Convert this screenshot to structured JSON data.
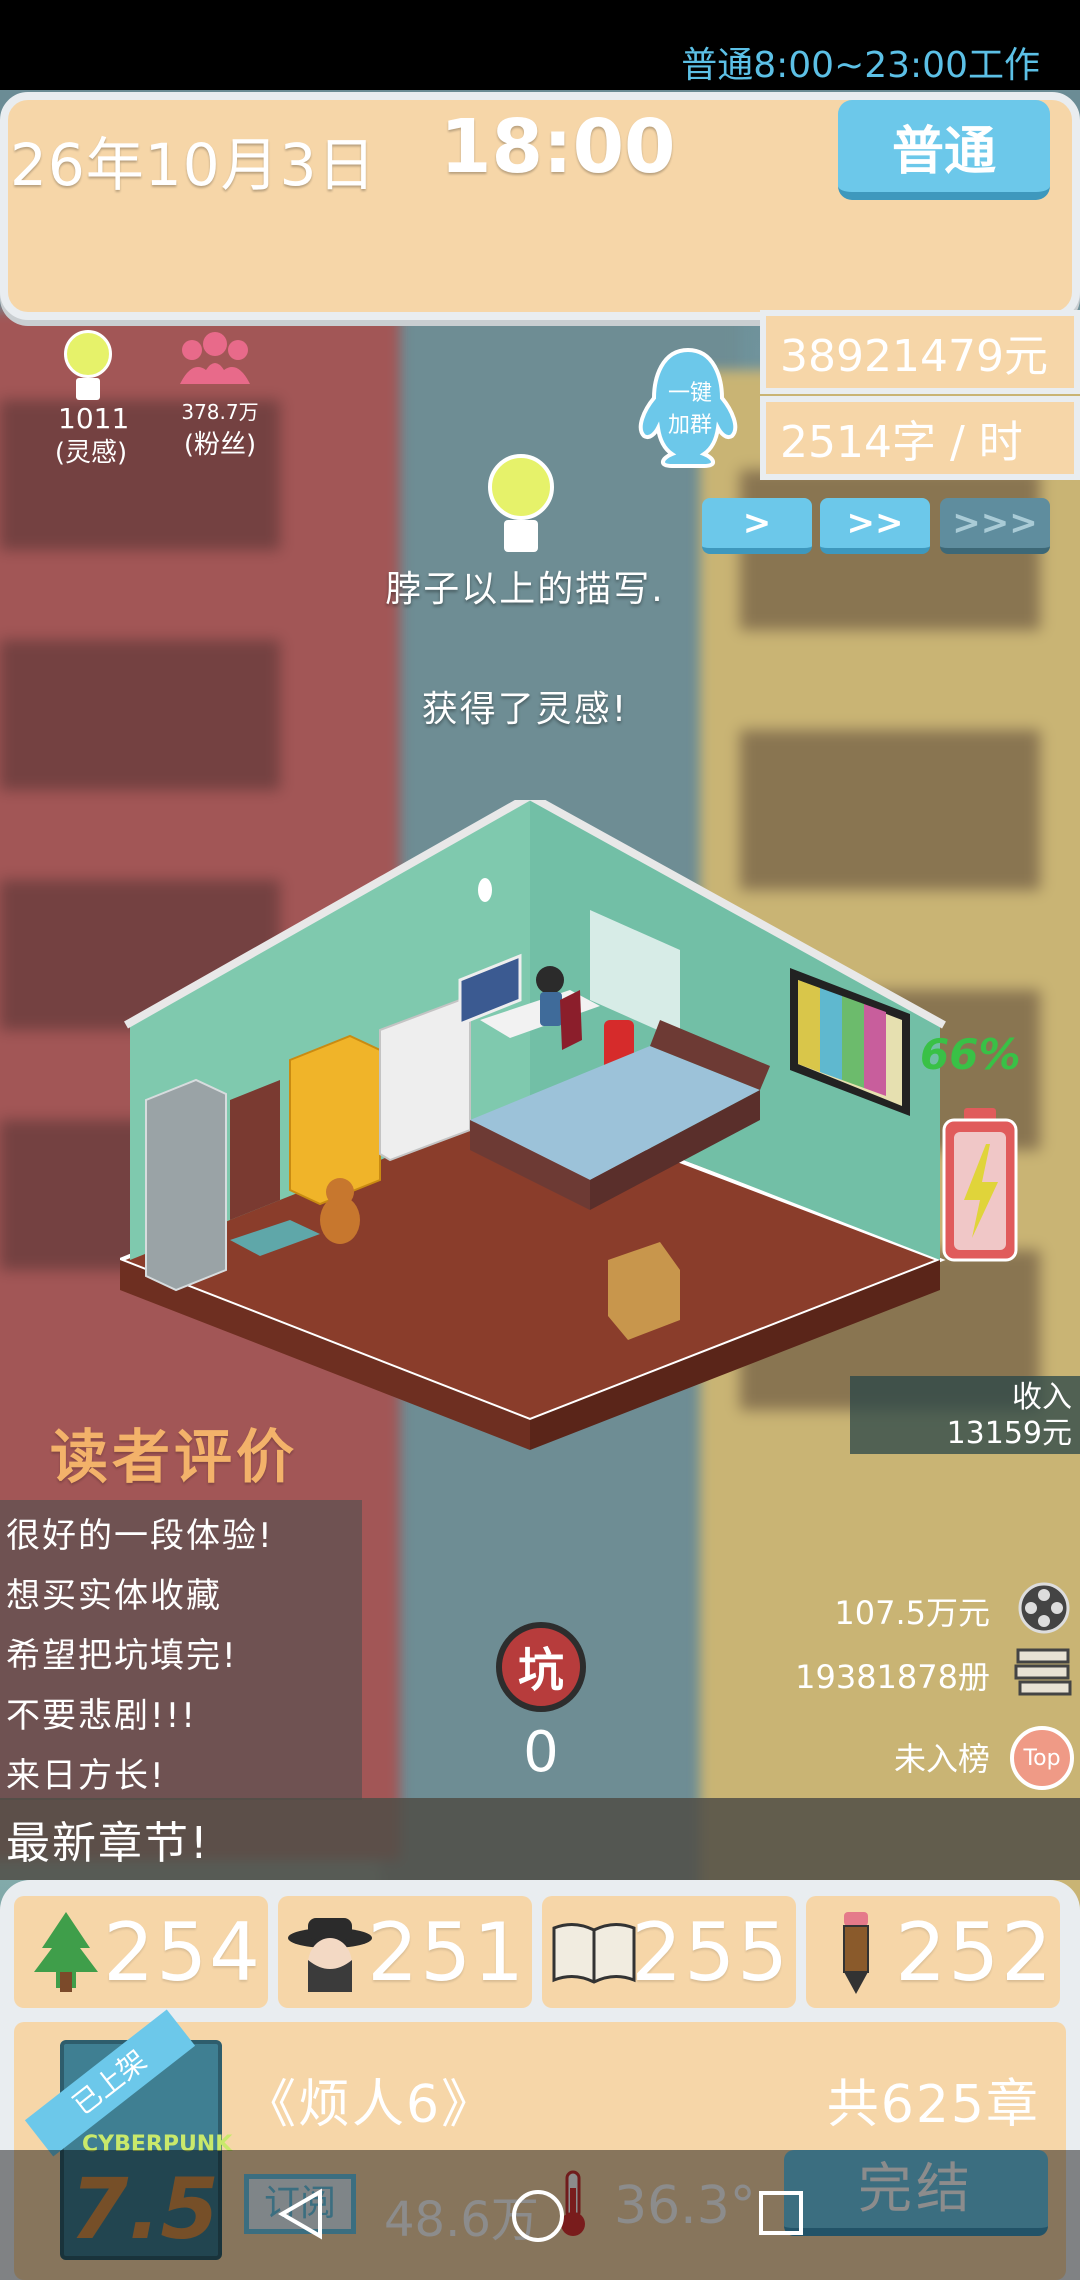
{
  "header": {
    "work_hours": "普通8:00~23:00工作",
    "date": "26年10月3日",
    "time": "18:00",
    "mode_label": "普通"
  },
  "stats": {
    "money": "38921479元",
    "speed": "2514字 / 时",
    "inspiration_value": "1011",
    "inspiration_label": "(灵感)",
    "fans_value": "378.7万",
    "fans_label": "(粉丝)"
  },
  "qq_group": {
    "line1": "一键",
    "line2": "加群"
  },
  "speed_buttons": [
    ">",
    ">>",
    ">>>"
  ],
  "messages": {
    "line1": "脖子以上的描写.",
    "line2": "获得了灵感!"
  },
  "battery": {
    "percent_text": "66%",
    "level": 0.66
  },
  "income": {
    "label": "收入",
    "value": "13159元"
  },
  "reviews": {
    "title": "读者评价",
    "items": [
      "很好的一段体验!",
      "想买实体收藏",
      "希望把坑填完!",
      "不要悲剧!!!",
      "来日方长!"
    ]
  },
  "sales": {
    "money": "107.5万元",
    "copies": "19381878册",
    "rank": "未入榜",
    "top_badge": "Top"
  },
  "pit": {
    "label": "坑",
    "count": "0"
  },
  "latest_chapter": "最新章节!",
  "attributes": [
    {
      "icon": "tree-icon",
      "value": "254"
    },
    {
      "icon": "detective-icon",
      "value": "251"
    },
    {
      "icon": "open-book-icon",
      "value": "255"
    },
    {
      "icon": "pencil-icon",
      "value": "252"
    }
  ],
  "book": {
    "shelf_tag": "已上架",
    "cover_text": "CYBERPUNK",
    "rating": "7.5",
    "title": "《烦人6》",
    "chapters": "共625章",
    "subscription_label": "订阅",
    "subscription_value": "48.6万",
    "temperature": "36.3°",
    "finish_label": "完结"
  },
  "colors": {
    "panel": "#f6d6a8",
    "accent_blue": "#6cc8ea",
    "battery_red": "#e05b5b",
    "battery_green": "#39c146",
    "review_title": "#f3b26a"
  }
}
